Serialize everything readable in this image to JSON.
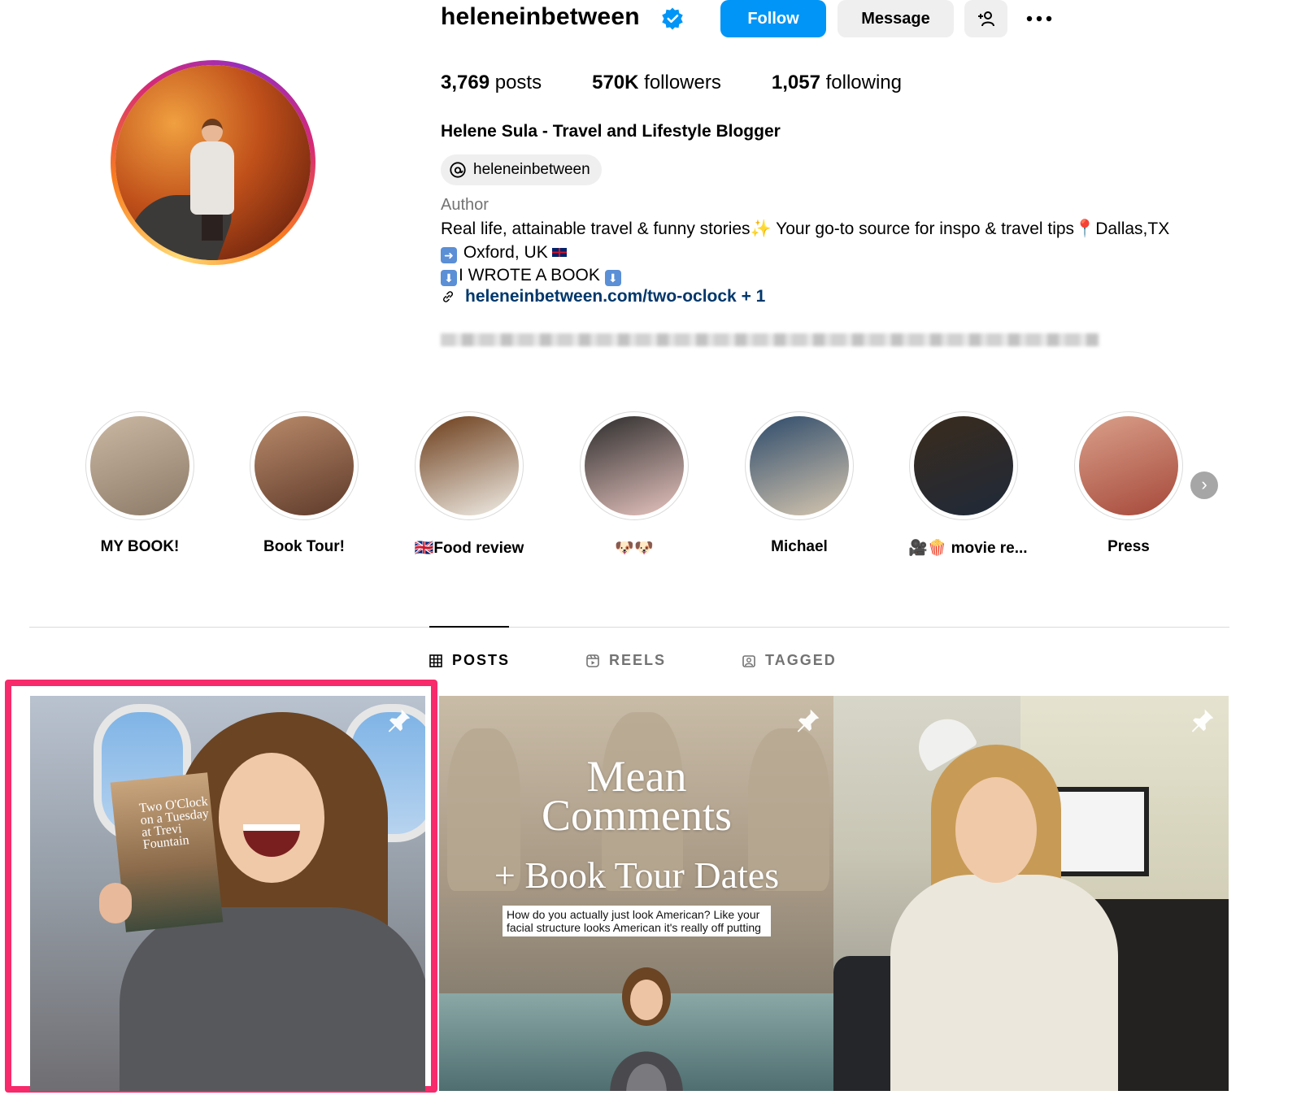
{
  "profile": {
    "username": "heleneinbetween",
    "buttons": {
      "follow": "Follow",
      "message": "Message"
    },
    "stats": {
      "posts_count": "3,769",
      "posts_label": "posts",
      "followers_count": "570K",
      "followers_label": "followers",
      "following_count": "1,057",
      "following_label": "following"
    },
    "full_name": "Helene Sula - Travel and Lifestyle Blogger",
    "threads_handle": "heleneinbetween",
    "category": "Author",
    "bio": {
      "line1": "Real life, attainable travel & funny stories✨ Your go-to source for inspo & travel tips📍Dallas,TX",
      "line2_text": " Oxford, UK",
      "line3_text": "I WROTE A BOOK "
    },
    "link": "heleneinbetween.com/two-oclock + 1"
  },
  "highlights": [
    {
      "label": "MY BOOK!",
      "colors": [
        "#cbb8a3",
        "#8c7a68"
      ]
    },
    {
      "label": "Book Tour!",
      "colors": [
        "#b98a6a",
        "#5e3a2a"
      ]
    },
    {
      "label": "🇬🇧Food review",
      "colors": [
        "#6b3b18",
        "#f2efe8"
      ]
    },
    {
      "label": "🐶🐶",
      "colors": [
        "#2b2b2b",
        "#e8c5c0"
      ]
    },
    {
      "label": "Michael",
      "colors": [
        "#2c4a6a",
        "#d7c7b0"
      ]
    },
    {
      "label": "🎥🍿 movie re...",
      "colors": [
        "#3a2b1c",
        "#1f2a3a"
      ]
    },
    {
      "label": "Press",
      "colors": [
        "#d9a08a",
        "#a6483a"
      ]
    }
  ],
  "tabs": [
    {
      "label": "POSTS",
      "icon": "grid-icon",
      "active": true
    },
    {
      "label": "REELS",
      "icon": "reels-icon",
      "active": false
    },
    {
      "label": "TAGGED",
      "icon": "tagged-icon",
      "active": false
    }
  ],
  "posts": {
    "post1": {
      "book_title": "Two O'Clock on a Tuesday at Trevi Fountain"
    },
    "post2": {
      "title1": "Mean",
      "title2": "Comments",
      "title3": "+ Book Tour Dates",
      "caption": "How do you actually just look American? Like your facial structure looks American it's really off putting"
    }
  },
  "colors": {
    "accent": "#0095f6",
    "link": "#00376b",
    "highlight_frame": "#f72a6b"
  }
}
